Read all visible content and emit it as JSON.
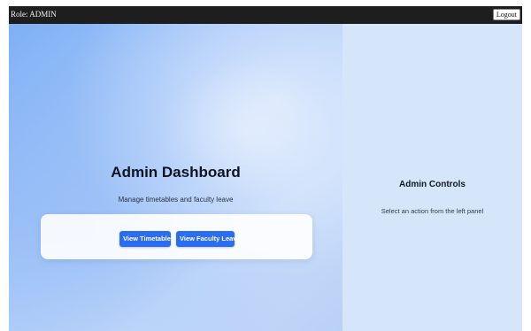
{
  "header": {
    "role_label": "Role: ADMIN",
    "logout_label": "Logout"
  },
  "dashboard": {
    "title": "Admin Dashboard",
    "subtitle": "Manage timetables and faculty leave",
    "buttons": {
      "view_timetables": "View Timetables",
      "view_faculty_leave": "View Faculty Leave"
    }
  },
  "controls": {
    "title": "Admin Controls",
    "subtitle": "Select an action from the left panel"
  },
  "colors": {
    "topbar": "#1e1e1e",
    "accent_button": "#2a6df0",
    "right_panel": "#d6e6fa"
  }
}
